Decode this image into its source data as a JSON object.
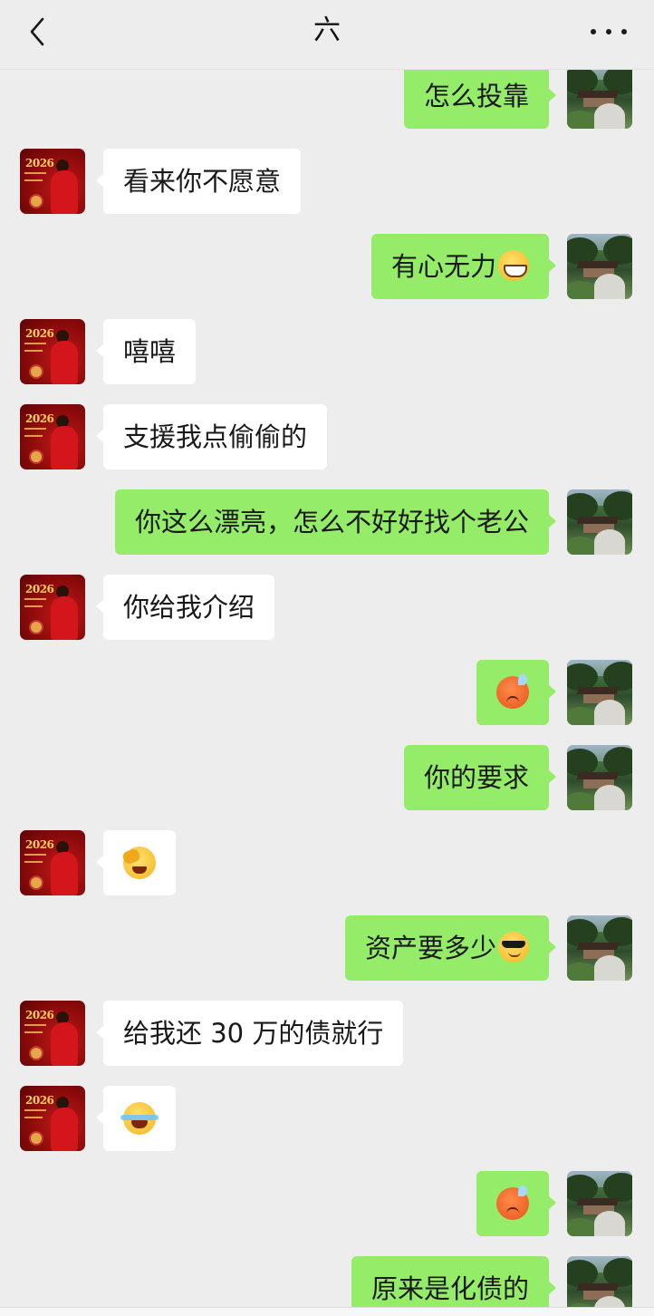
{
  "header": {
    "title": "六"
  },
  "messages": [
    {
      "side": "right",
      "text": "怎么投靠"
    },
    {
      "side": "left",
      "text": "看来你不愿意"
    },
    {
      "side": "right",
      "text": "有心无力",
      "emoji": "grin-emoji"
    },
    {
      "side": "left",
      "text": "嘻嘻"
    },
    {
      "side": "left",
      "text": "支援我点偷偷的"
    },
    {
      "side": "right",
      "text": "你这么漂亮，怎么不好好找个老公"
    },
    {
      "side": "left",
      "text": "你给我介绍"
    },
    {
      "side": "right",
      "text": "",
      "emoji": "hot-face-emoji"
    },
    {
      "side": "right",
      "text": "你的要求"
    },
    {
      "side": "left",
      "text": "",
      "emoji": "face-palm-emoji"
    },
    {
      "side": "right",
      "text": "资产要多少",
      "emoji": "sunglasses-emoji"
    },
    {
      "side": "left",
      "text": "给我还 30 万的债就行"
    },
    {
      "side": "left",
      "text": "",
      "emoji": "tears-of-joy-emoji"
    },
    {
      "side": "right",
      "text": "",
      "emoji": "hot-face-emoji"
    },
    {
      "side": "right",
      "text": "原来是化债的"
    }
  ],
  "avatar_left": {
    "year": "2026"
  },
  "colors": {
    "background": "#ededed",
    "bubble_self": "#95ec69",
    "bubble_other": "#ffffff"
  }
}
